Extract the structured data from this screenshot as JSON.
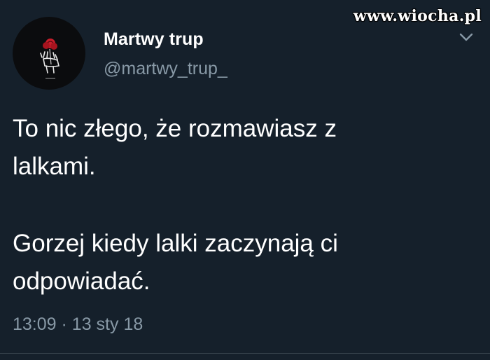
{
  "watermark": {
    "text": "www.wiocha.pl"
  },
  "author": {
    "display_name": "Martwy trup",
    "handle": "@martwy_trup_",
    "avatar_icon": "skeleton-hand-rose-icon"
  },
  "menu": {
    "icon": "chevron-down-icon"
  },
  "tweet": {
    "lines": [
      "To nic złego, że rozmawiasz z",
      "lalkami.",
      "Gorzej kiedy lalki zaczynają ci",
      "odpowiadać."
    ],
    "time": "13:09",
    "separator": "·",
    "date": "13 sty 18"
  },
  "colors": {
    "background": "#15202b",
    "primary_text": "#ffffff",
    "secondary_text": "#8899a6",
    "rose": "#c81e2b"
  }
}
